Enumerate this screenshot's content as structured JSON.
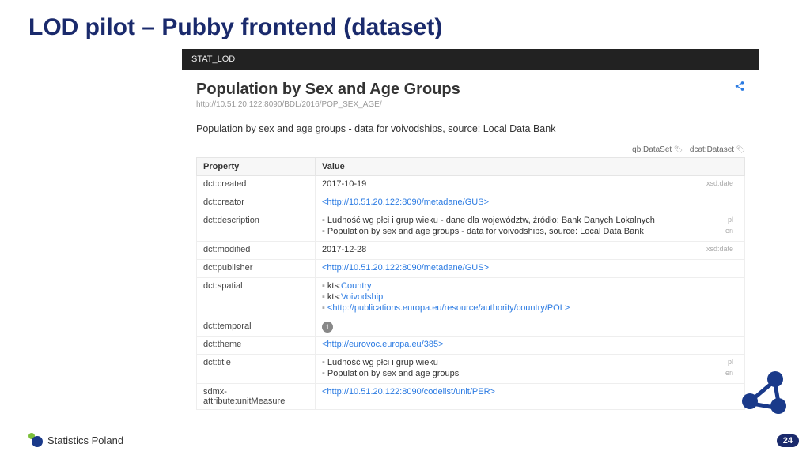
{
  "slide": {
    "title": "LOD pilot – Pubby frontend (dataset)",
    "page_number": "24"
  },
  "footer": {
    "org": "Statistics Poland"
  },
  "app": {
    "brand": "STAT_LOD",
    "title": "Population by Sex and Age Groups",
    "uri": "http://10.51.20.122:8090/BDL/2016/POP_SEX_AGE/",
    "description": "Population by sex and age groups - data for voivodships, source: Local Data Bank",
    "types": [
      "qb:DataSet",
      "dcat:Dataset"
    ],
    "col_property": "Property",
    "col_value": "Value",
    "rows": [
      {
        "prop": "dct:created",
        "values": [
          {
            "text": "2017-10-19",
            "meta": "xsd:date"
          }
        ]
      },
      {
        "prop": "dct:creator",
        "values": [
          {
            "text": "<http://10.51.20.122:8090/metadane/GUS>",
            "link": true
          }
        ]
      },
      {
        "prop": "dct:description",
        "values": [
          {
            "bullet": true,
            "text": "Ludność wg płci i grup wieku - dane dla województw, źródło: Bank Danych Lokalnych",
            "meta": "pl"
          },
          {
            "bullet": true,
            "text": "Population by sex and age groups - data for voivodships, source: Local Data Bank",
            "meta": "en"
          }
        ]
      },
      {
        "prop": "dct:modified",
        "values": [
          {
            "text": "2017-12-28",
            "meta": "xsd:date"
          }
        ]
      },
      {
        "prop": "dct:publisher",
        "values": [
          {
            "text": "<http://10.51.20.122:8090/metadane/GUS>",
            "link": true
          }
        ]
      },
      {
        "prop": "dct:spatial",
        "values": [
          {
            "bullet": true,
            "prefix": "kts:",
            "text": "Country",
            "link": true
          },
          {
            "bullet": true,
            "prefix": "kts:",
            "text": "Voivodship",
            "link": true
          },
          {
            "bullet": true,
            "text": "<http://publications.europa.eu/resource/authority/country/POL>",
            "link": true
          }
        ]
      },
      {
        "prop": "dct:temporal",
        "values": [
          {
            "badge": "1"
          }
        ]
      },
      {
        "prop": "dct:theme",
        "values": [
          {
            "text": "<http://eurovoc.europa.eu/385>",
            "link": true
          }
        ]
      },
      {
        "prop": "dct:title",
        "values": [
          {
            "bullet": true,
            "text": "Ludność wg płci i grup wieku",
            "meta": "pl"
          },
          {
            "bullet": true,
            "text": "Population by sex and age groups",
            "meta": "en"
          }
        ]
      },
      {
        "prop": "sdmx-attribute:unitMeasure",
        "values": [
          {
            "text": "<http://10.51.20.122:8090/codelist/unit/PER>",
            "link": true
          }
        ]
      }
    ]
  }
}
